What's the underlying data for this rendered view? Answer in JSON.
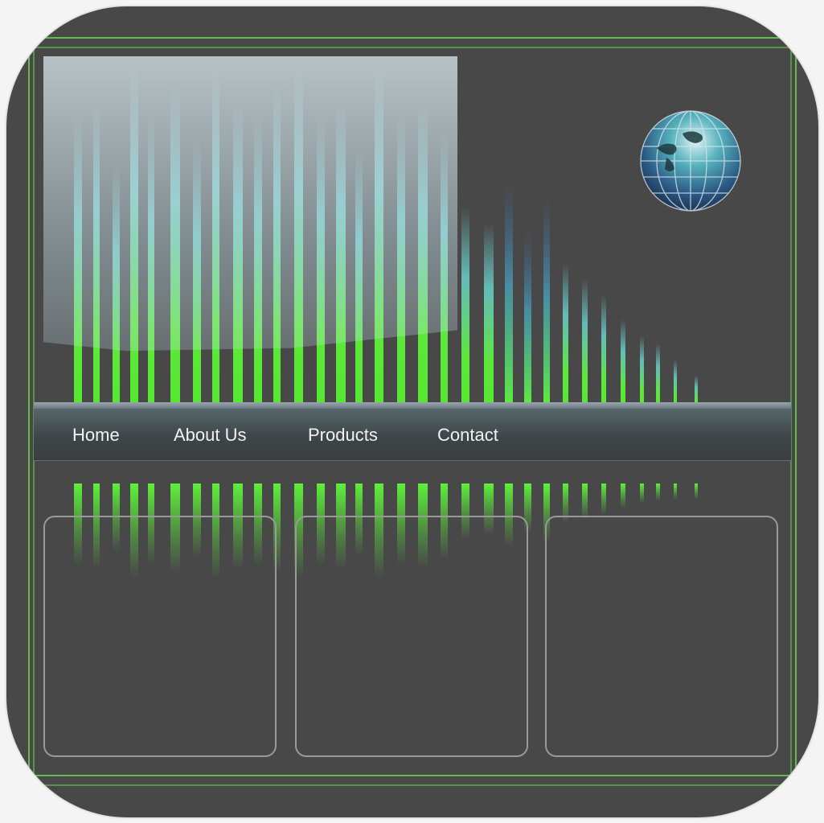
{
  "nav": {
    "items": [
      {
        "label": "Home"
      },
      {
        "label": "About Us"
      },
      {
        "label": "Products"
      },
      {
        "label": "Contact"
      }
    ]
  },
  "colors": {
    "background": "#484848",
    "accent_green": "#6bd04c",
    "bar_green": "#5ef03a",
    "bar_cyan": "#6fe0dc",
    "panel_border": "#9a9a9a"
  },
  "icons": {
    "globe": "globe-icon"
  }
}
